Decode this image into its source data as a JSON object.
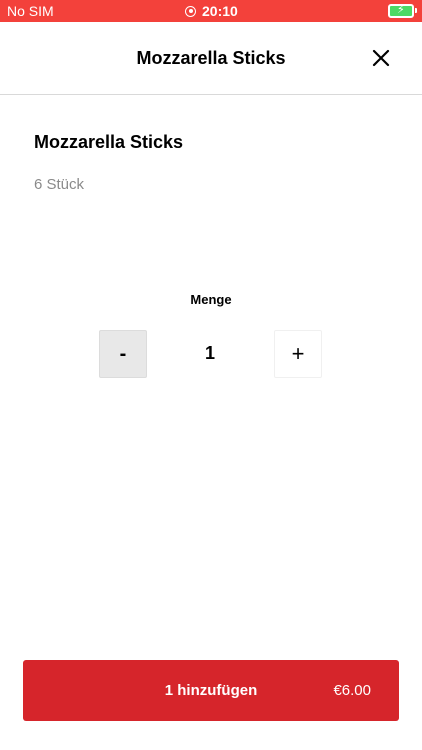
{
  "status_bar": {
    "carrier": "No SIM",
    "time": "20:10",
    "color": "#f3413b"
  },
  "header": {
    "title": "Mozzarella Sticks",
    "close_icon": "close-icon"
  },
  "item": {
    "name": "Mozzarella Sticks",
    "description": "6 Stück"
  },
  "quantity": {
    "label": "Menge",
    "value": "1",
    "minus_label": "-",
    "plus_label": "+"
  },
  "cart_button": {
    "label": "1 hinzufügen",
    "price": "€6.00",
    "color": "#d6252b"
  }
}
